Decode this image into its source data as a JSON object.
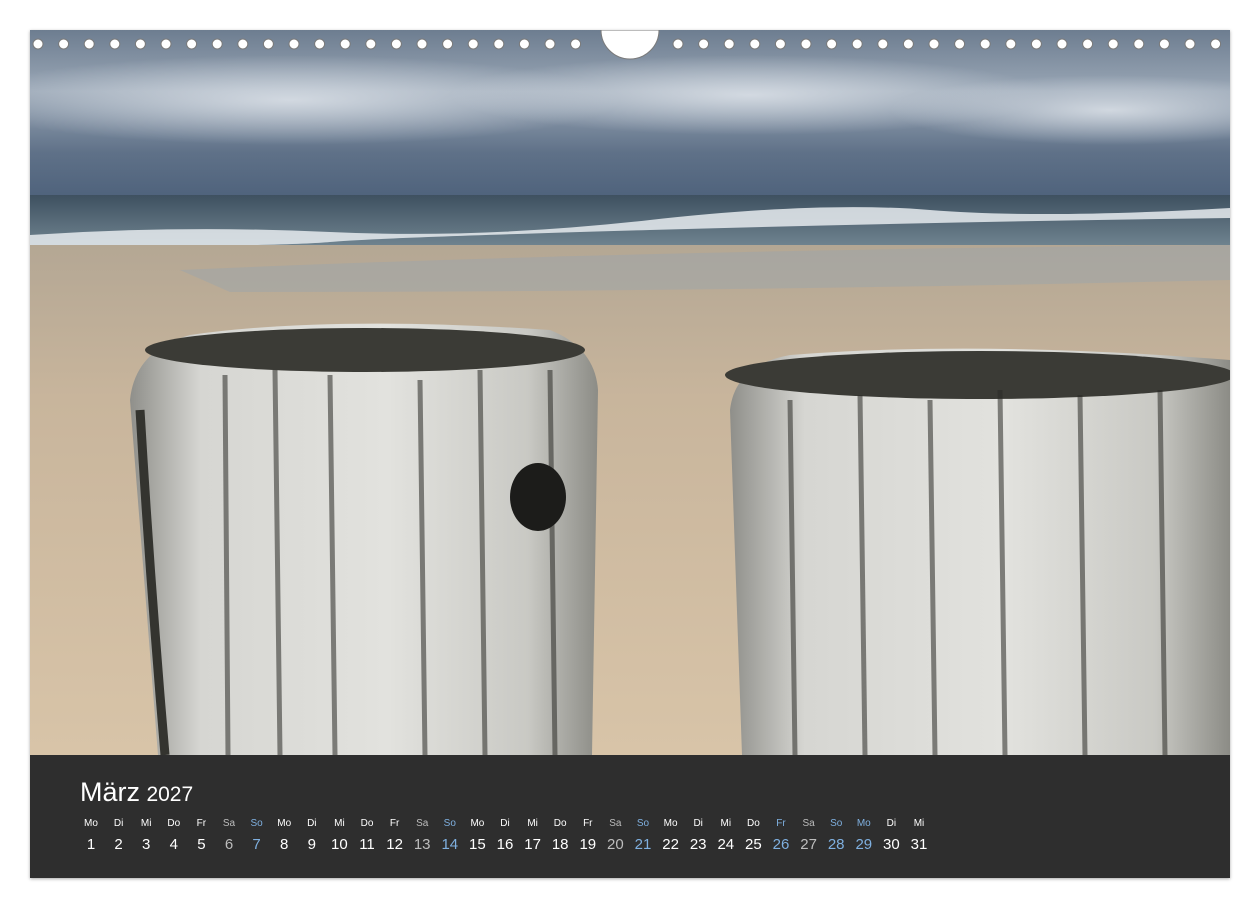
{
  "calendar": {
    "month": "März",
    "year": "2027",
    "days": [
      {
        "dow": "Mo",
        "num": "1",
        "kind": "weekday"
      },
      {
        "dow": "Di",
        "num": "2",
        "kind": "weekday"
      },
      {
        "dow": "Mi",
        "num": "3",
        "kind": "weekday"
      },
      {
        "dow": "Do",
        "num": "4",
        "kind": "weekday"
      },
      {
        "dow": "Fr",
        "num": "5",
        "kind": "weekday"
      },
      {
        "dow": "Sa",
        "num": "6",
        "kind": "saturday"
      },
      {
        "dow": "So",
        "num": "7",
        "kind": "holiday"
      },
      {
        "dow": "Mo",
        "num": "8",
        "kind": "weekday"
      },
      {
        "dow": "Di",
        "num": "9",
        "kind": "weekday"
      },
      {
        "dow": "Mi",
        "num": "10",
        "kind": "weekday"
      },
      {
        "dow": "Do",
        "num": "11",
        "kind": "weekday"
      },
      {
        "dow": "Fr",
        "num": "12",
        "kind": "weekday"
      },
      {
        "dow": "Sa",
        "num": "13",
        "kind": "saturday"
      },
      {
        "dow": "So",
        "num": "14",
        "kind": "holiday"
      },
      {
        "dow": "Mo",
        "num": "15",
        "kind": "weekday"
      },
      {
        "dow": "Di",
        "num": "16",
        "kind": "weekday"
      },
      {
        "dow": "Mi",
        "num": "17",
        "kind": "weekday"
      },
      {
        "dow": "Do",
        "num": "18",
        "kind": "weekday"
      },
      {
        "dow": "Fr",
        "num": "19",
        "kind": "weekday"
      },
      {
        "dow": "Sa",
        "num": "20",
        "kind": "saturday"
      },
      {
        "dow": "So",
        "num": "21",
        "kind": "holiday"
      },
      {
        "dow": "Mo",
        "num": "22",
        "kind": "weekday"
      },
      {
        "dow": "Di",
        "num": "23",
        "kind": "weekday"
      },
      {
        "dow": "Mi",
        "num": "24",
        "kind": "weekday"
      },
      {
        "dow": "Do",
        "num": "25",
        "kind": "weekday"
      },
      {
        "dow": "Fr",
        "num": "26",
        "kind": "holiday"
      },
      {
        "dow": "Sa",
        "num": "27",
        "kind": "saturday"
      },
      {
        "dow": "So",
        "num": "28",
        "kind": "holiday"
      },
      {
        "dow": "Mo",
        "num": "29",
        "kind": "holiday"
      },
      {
        "dow": "Di",
        "num": "30",
        "kind": "weekday"
      },
      {
        "dow": "Mi",
        "num": "31",
        "kind": "weekday"
      }
    ]
  },
  "colors": {
    "panel": "#2e2e2e",
    "text": "#ffffff",
    "saturday": "#bdbdbd",
    "sunday_holiday": "#7fb0e0"
  },
  "photo": {
    "subject": "two weathered wooden groyne posts on a beach with sea and cloudy sky"
  }
}
